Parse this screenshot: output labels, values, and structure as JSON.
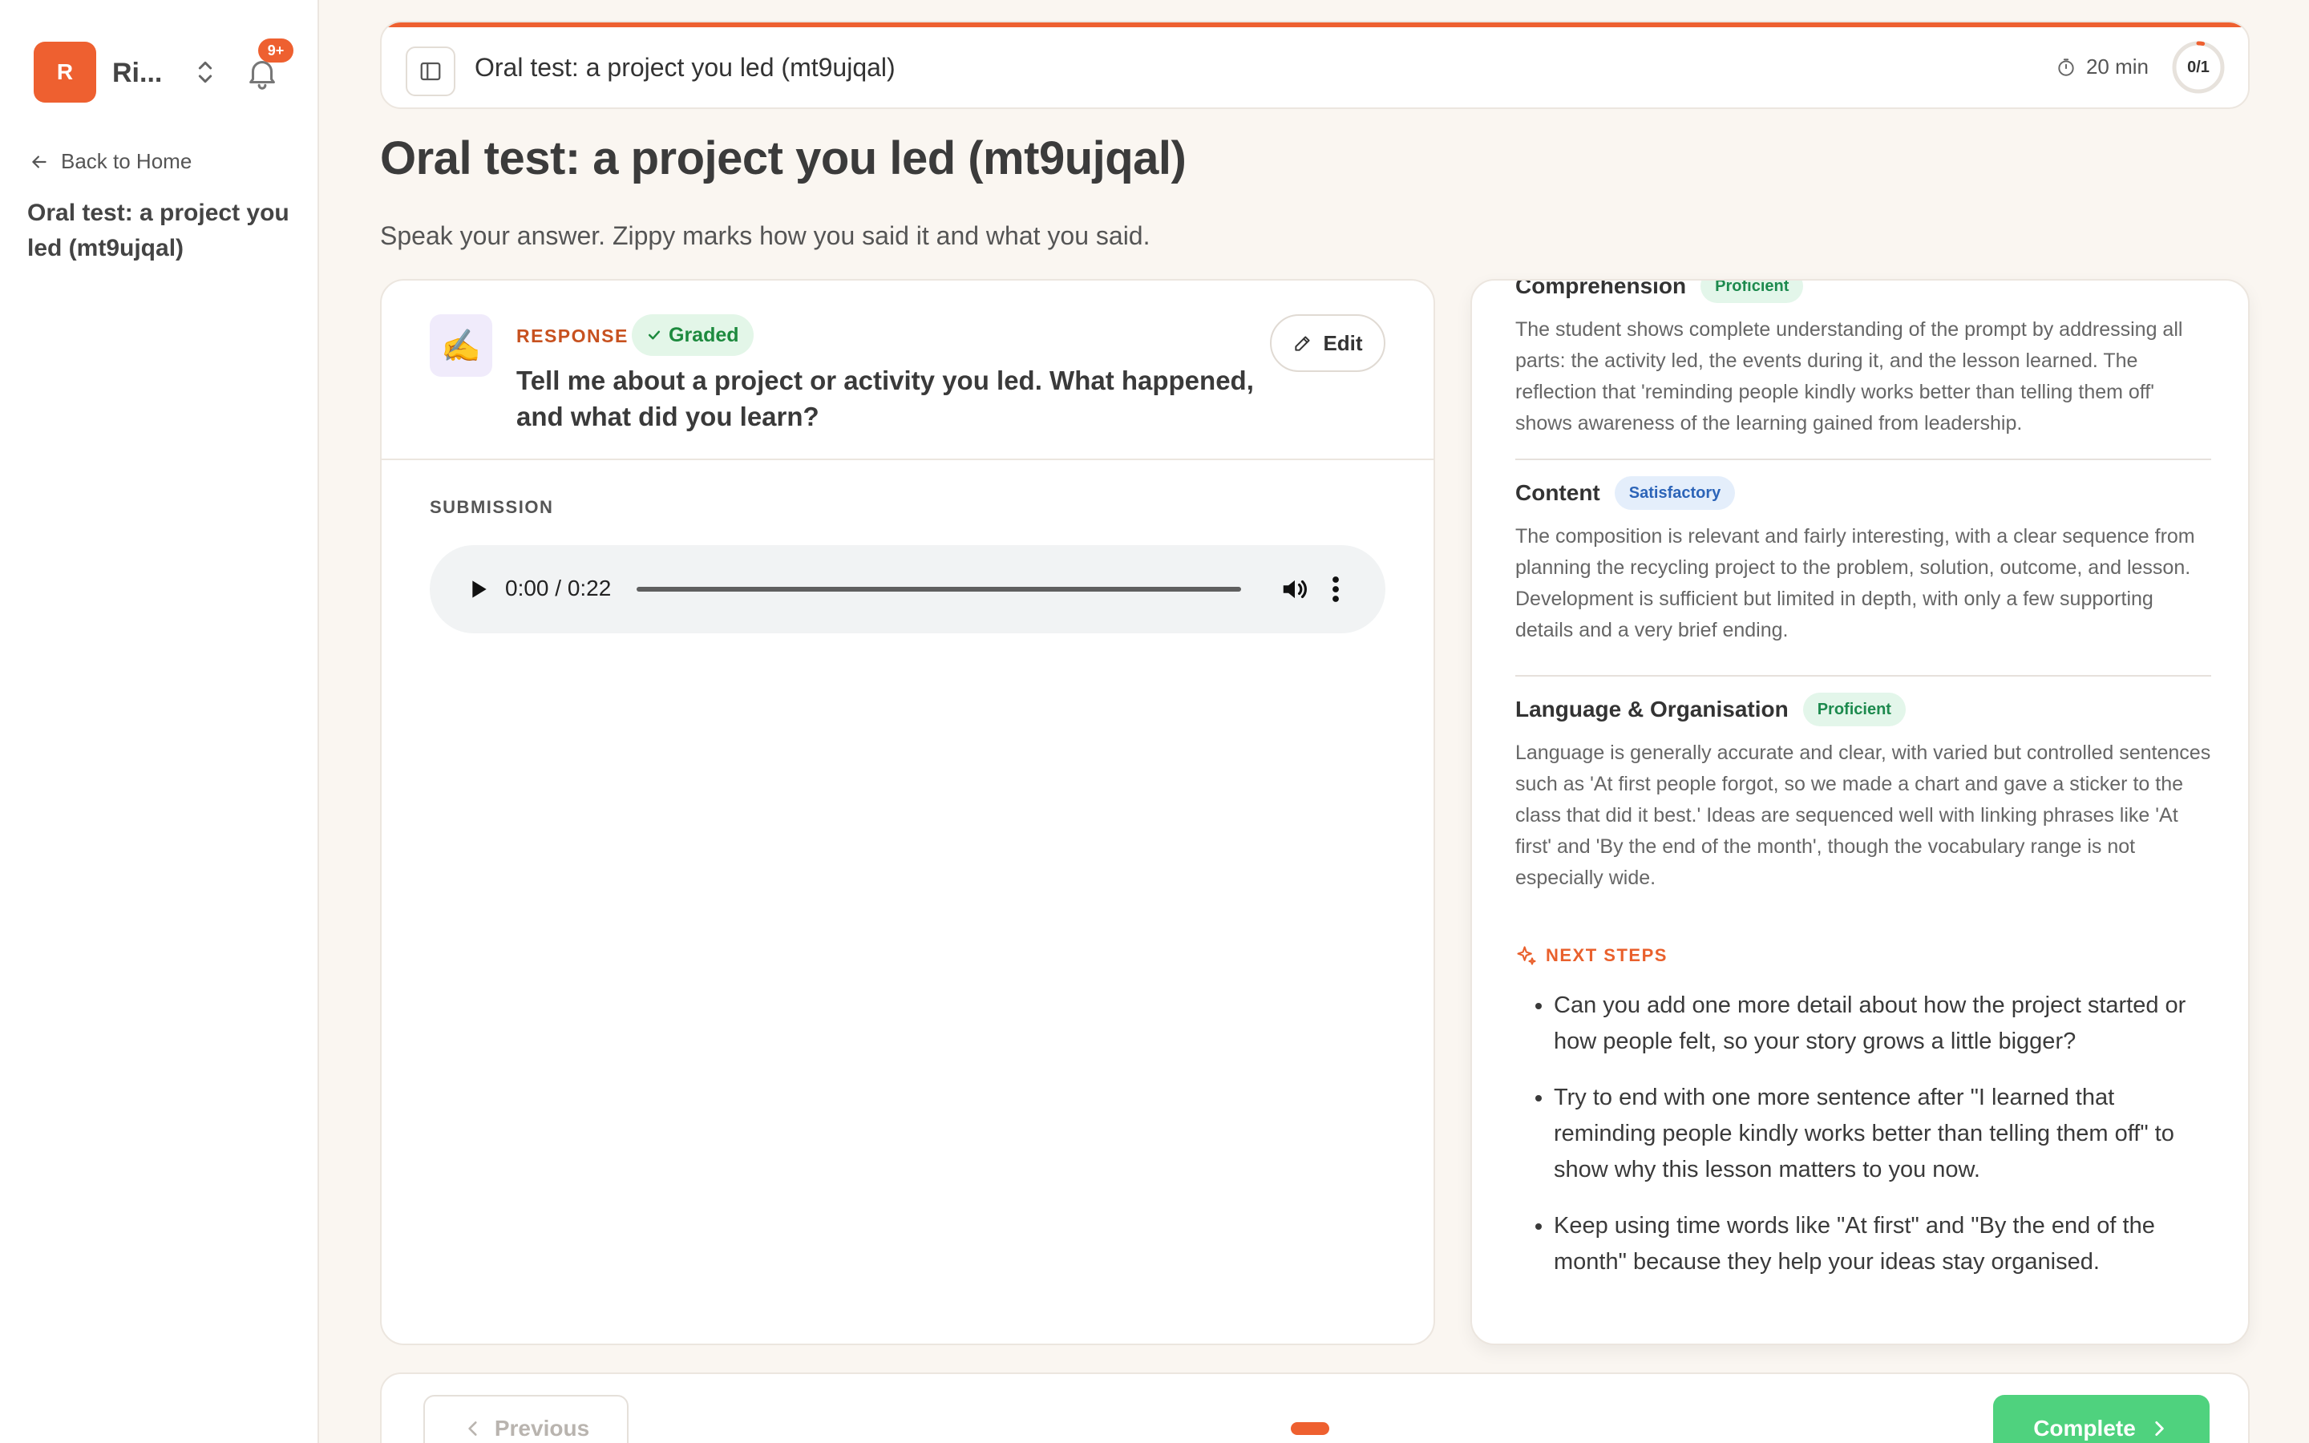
{
  "sidebar": {
    "avatar_initial": "R",
    "brand_name": "Ri...",
    "notification_count": "9+",
    "back_label": "Back to Home",
    "lesson_title": "Oral test: a project you led (mt9ujqal)"
  },
  "topbar": {
    "title": "Oral test: a project you led (mt9ujqal)",
    "timer": "20 min",
    "progress": "0/1",
    "progress_fraction": 0.0
  },
  "page": {
    "title": "Oral test: a project you led (mt9ujqal)",
    "subtitle": "Speak your answer. Zippy marks how you said it and what you said."
  },
  "response": {
    "icon": "✍️",
    "label": "RESPONSE",
    "status": "Graded",
    "edit_label": "Edit",
    "question": "Tell me about a project or activity you led. What happened, and what did you learn?",
    "submission_label": "SUBMISSION",
    "audio_time": "0:00 / 0:22"
  },
  "feedback": {
    "criteria": [
      {
        "name": "Comprehension",
        "level": "Proficient",
        "text": "The student shows complete understanding of the prompt by addressing all parts: the activity led, the events during it, and the lesson learned. The reflection that 'reminding people kindly works better than telling them off' shows awareness of the learning gained from leadership."
      },
      {
        "name": "Content",
        "level": "Satisfactory",
        "text": "The composition is relevant and fairly interesting, with a clear sequence from planning the recycling project to the problem, solution, outcome, and lesson. Development is sufficient but limited in depth, with only a few supporting details and a very brief ending."
      },
      {
        "name": "Language & Organisation",
        "level": "Proficient",
        "text": "Language is generally accurate and clear, with varied but controlled sentences such as 'At first people forgot, so we made a chart and gave a sticker to the class that did it best.' Ideas are sequenced well with linking phrases like 'At first' and 'By the end of the month', though the vocabulary range is not especially wide."
      }
    ],
    "next_steps_label": "NEXT STEPS",
    "next_steps": [
      "Can you add one more detail about how the project started or how people felt, so your story grows a little bigger?",
      "Try to end with one more sentence after \"I learned that reminding people kindly works better than telling them off\" to show why this lesson matters to you now.",
      "Keep using time words like \"At first\" and \"By the end of the month\" because they help your ideas stay organised."
    ]
  },
  "footer": {
    "previous_label": "Previous",
    "complete_label": "Complete"
  },
  "colors": {
    "accent": "#ee6030",
    "success": "#4fd27e",
    "background": "#faf6f1"
  }
}
